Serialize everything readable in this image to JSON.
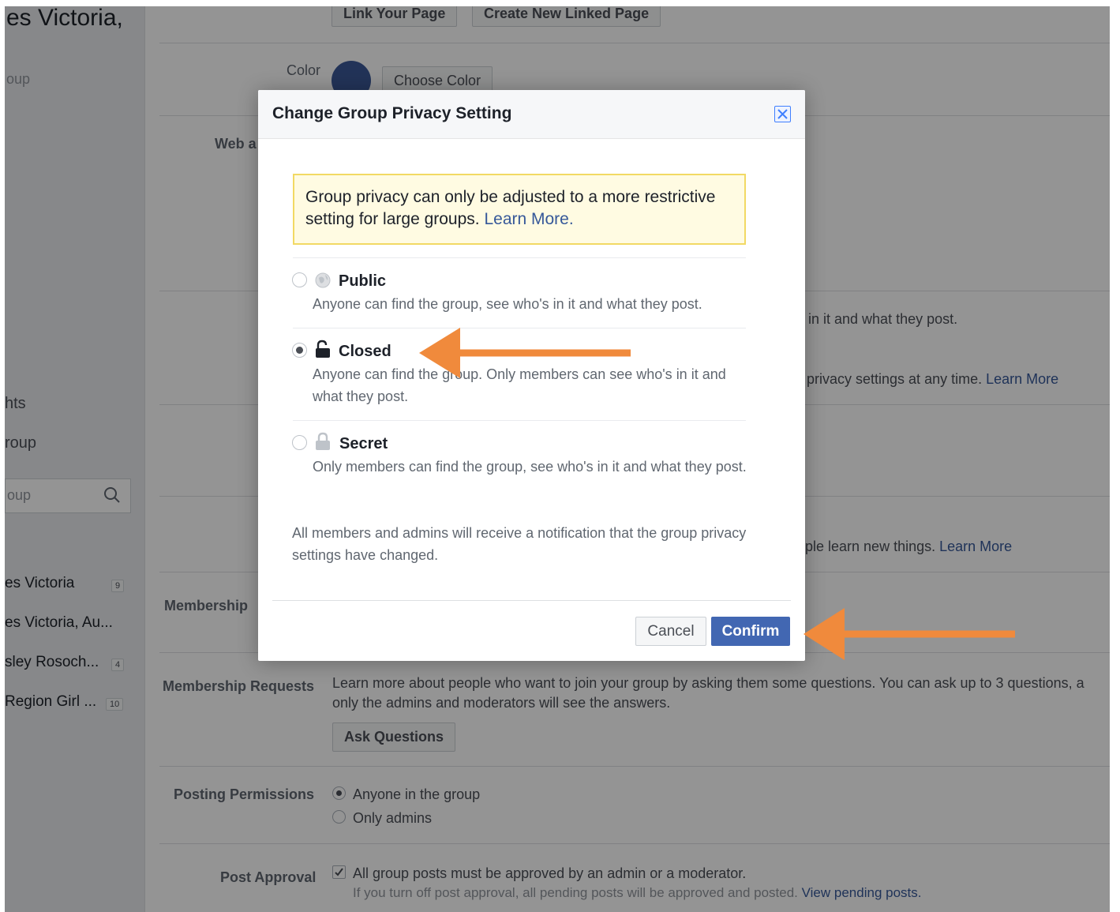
{
  "sidebar": {
    "title": "es Victoria,",
    "group_label": "oup",
    "rights_label": "hts",
    "group_label_2": "roup",
    "search_placeholder": "oup",
    "groups": [
      {
        "name": "es Victoria",
        "badge": "9"
      },
      {
        "name": "es Victoria, Au...",
        "badge": ""
      },
      {
        "name": "sley Rosoch...",
        "badge": "4"
      },
      {
        "name": "Region Girl ...",
        "badge": "10"
      }
    ]
  },
  "settings": {
    "link_page_button": "Link Your Page",
    "create_linked_page_button": "Create New Linked Page",
    "color_label": "Color",
    "choose_color_button": "Choose Color",
    "web_address_label": "Web a",
    "privacy_bg_text": "in it and what they post.",
    "privacy_bg_note": "privacy settings at any time.",
    "privacy_bg_learn_more": "Learn More",
    "group_type_bg_text": "ple learn new things.",
    "group_type_bg_learn_more": "Learn More",
    "membership_label": "Membership",
    "membership_requests_label": "Membership Requests",
    "membership_requests_text_1": "Learn more about people who want to join your group by asking them some questions. You can ask up to 3 questions, a",
    "membership_requests_text_2": "only the admins and moderators will see the answers.",
    "ask_questions_button": "Ask Questions",
    "posting_permissions_label": "Posting Permissions",
    "posting_options": [
      "Anyone in the group",
      "Only admins"
    ],
    "post_approval_label": "Post Approval",
    "post_approval_text": "All group posts must be approved by an admin or a moderator.",
    "post_approval_note": "If you turn off post approval, all pending posts will be approved and posted.",
    "view_pending_posts_link": "View pending posts."
  },
  "dialog": {
    "title": "Change Group Privacy Setting",
    "notice_text": "Group privacy can only be adjusted to a more restrictive setting for large groups.",
    "notice_link": "Learn More.",
    "options": [
      {
        "name": "Public",
        "desc": "Anyone can find the group, see who's in it and what they post.",
        "selected": false
      },
      {
        "name": "Closed",
        "desc": "Anyone can find the group. Only members can see who's in it and what they post.",
        "selected": true
      },
      {
        "name": "Secret",
        "desc": "Only members can find the group, see who's in it and what they post.",
        "selected": false
      }
    ],
    "notify_text": "All members and admins will receive a notification that the group privacy settings have changed.",
    "cancel_label": "Cancel",
    "confirm_label": "Confirm"
  },
  "colors": {
    "accent": "#4267b2",
    "link": "#365899",
    "annotation_arrow": "#f08a3c",
    "group_color": "#3b5998"
  },
  "icons": {
    "close": "close-icon",
    "public": "globe-icon",
    "closed": "lock-open-icon",
    "secret": "lock-icon",
    "search": "search-icon"
  }
}
